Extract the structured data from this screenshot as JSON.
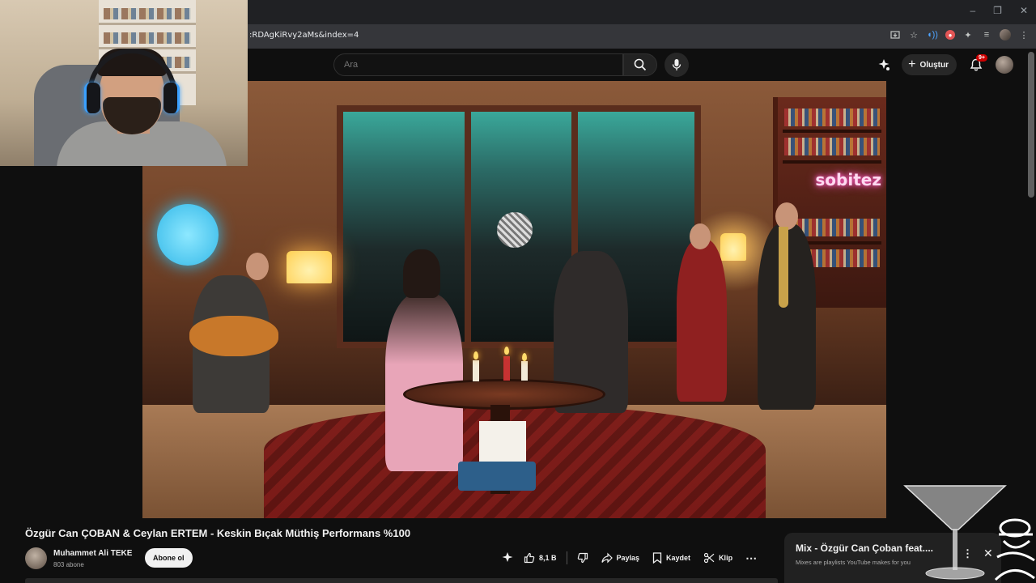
{
  "browser": {
    "url": ":RDAgKiRvy2aMs&index=4",
    "window_controls": [
      "–",
      "❐",
      "✕"
    ]
  },
  "header": {
    "search_placeholder": "Ara",
    "create_label": "Oluştur",
    "notifications_badge": "9+"
  },
  "video": {
    "title": "Özgür Can ÇOBAN & Ceylan ERTEM - Keskin Bıçak Müthiş Performans %100",
    "neon_sign": "sobitez"
  },
  "channel": {
    "name": "Muhammet Ali TEKE",
    "subscribers": "803 abone",
    "subscribe_label": "Abone ol"
  },
  "actions": {
    "like_count": "8,1 B",
    "share_label": "Paylaş",
    "save_label": "Kaydet",
    "clip_label": "Klip"
  },
  "mix": {
    "title": "Mix - Özgür Can Çoban feat....",
    "subtitle": "Mixes are playlists YouTube makes for you"
  },
  "colors": {
    "background": "#0f0f0f",
    "chrome_dark": "#202124",
    "address_bar": "#35363a",
    "badge_red": "#cc0000",
    "extension_blue": "#4ea3ff",
    "subscribe_bg": "#f1f1f1"
  },
  "icons": [
    "search-icon",
    "mic-icon",
    "create-icon",
    "bell-icon",
    "like-icon",
    "dislike-icon",
    "share-icon",
    "save-icon",
    "clip-icon",
    "more-icon",
    "close-icon",
    "star-icon",
    "bookmark-icon",
    "extensions-icon"
  ]
}
